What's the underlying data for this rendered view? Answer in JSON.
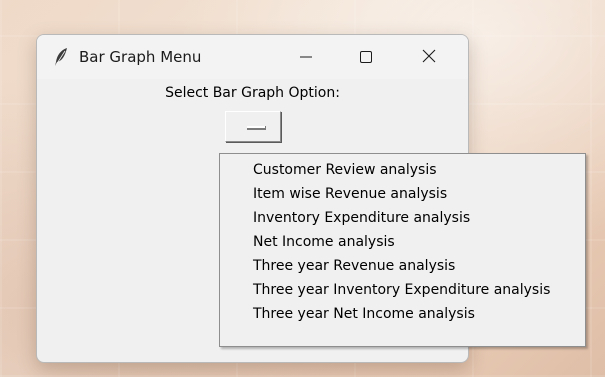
{
  "window": {
    "title": "Bar Graph Menu",
    "icon": "feather-icon",
    "controls": {
      "minimize_icon": "minimize-icon",
      "maximize_icon": "maximize-icon",
      "close_icon": "close-icon"
    }
  },
  "main": {
    "prompt": "Select Bar Graph Option:",
    "option_button": {
      "icon": "option-menu-indicator-icon",
      "selected_value": ""
    }
  },
  "dropdown": {
    "items": [
      {
        "label": "Customer Review analysis"
      },
      {
        "label": "Item wise Revenue analysis"
      },
      {
        "label": "Inventory Expenditure analysis"
      },
      {
        "label": "Net Income analysis"
      },
      {
        "label": "Three year Revenue analysis"
      },
      {
        "label": "Three year Inventory Expenditure analysis"
      },
      {
        "label": "Three year Net Income analysis"
      }
    ]
  },
  "colors": {
    "window_bg": "#f0f0f0",
    "menu_hover": "#0078d4",
    "close_hover": "#c42b1c"
  }
}
